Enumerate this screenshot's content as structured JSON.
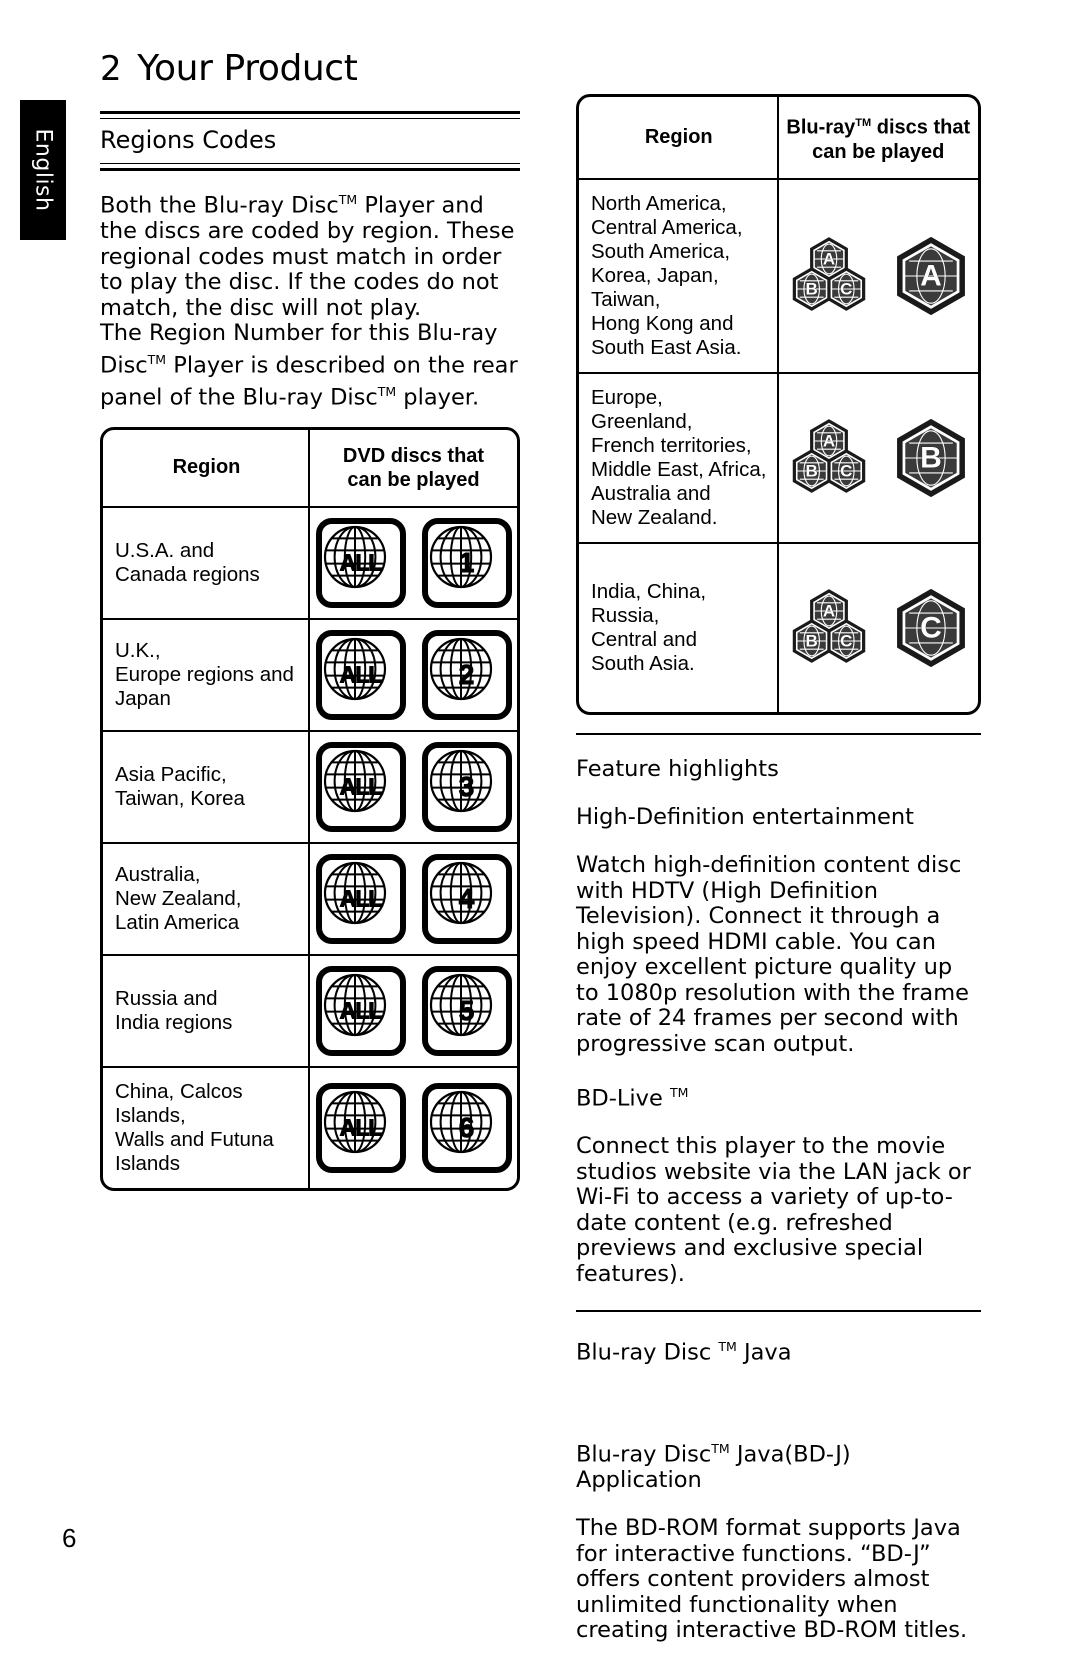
{
  "sidebar": {
    "language_tab": "English"
  },
  "header": {
    "chapter_number": "2",
    "chapter_title": "Your Product"
  },
  "section": {
    "title": "Regions Codes"
  },
  "intro": {
    "paragraph1_a": "Both the Blu-ray Disc",
    "paragraph1_b": " Player and the discs are coded by region. These regional codes must match in order to play the disc. If the codes do not match, the disc will not play.",
    "paragraph2_a": "The Region Number for this Blu-ray Disc",
    "paragraph2_b": " Player is described on the rear panel of the Blu-ray Disc",
    "paragraph2_c": " player.",
    "tm": "TM"
  },
  "dvd_table": {
    "header_region": "Region",
    "header_discs_line1": "DVD discs that",
    "header_discs_line2": "can be played",
    "rows": [
      {
        "region": "U.S.A. and\nCanada regions",
        "icons": [
          "ALL",
          "1"
        ]
      },
      {
        "region": "U.K.,\nEurope regions  and\nJapan",
        "icons": [
          "ALL",
          "2"
        ]
      },
      {
        "region": "Asia Pacific,\nTaiwan, Korea",
        "icons": [
          "ALL",
          "3"
        ]
      },
      {
        "region": "Australia,\nNew Zealand,\nLatin America",
        "icons": [
          "ALL",
          "4"
        ]
      },
      {
        "region": "Russia and\nIndia regions",
        "icons": [
          "ALL",
          "5"
        ]
      },
      {
        "region": "China, Calcos Islands,\nWalls and Futuna\nIslands",
        "icons": [
          "ALL",
          "6"
        ]
      }
    ]
  },
  "bluray_table": {
    "header_region": "Region",
    "header_discs_line1_a": "Blu-ray",
    "header_discs_line1_b": " discs that",
    "header_discs_line2": "can be played",
    "tm": "TM",
    "rows": [
      {
        "region": "North America,\nCentral America,\nSouth America,\nKorea, Japan, Taiwan,\nHong Kong and\nSouth East Asia.",
        "cluster": [
          "A",
          "B",
          "C"
        ],
        "main": "A"
      },
      {
        "region": "Europe, Greenland,\nFrench territories,\nMiddle East, Africa,\nAustralia and\nNew Zealand.",
        "cluster": [
          "A",
          "B",
          "C"
        ],
        "main": "B"
      },
      {
        "region": "India, China, Russia,\nCentral and\nSouth Asia.",
        "cluster": [
          "A",
          "B",
          "C"
        ],
        "main": "C"
      }
    ]
  },
  "features": {
    "heading": "Feature highlights",
    "subheading": "High-Definition entertainment",
    "body": "Watch high-definition content disc with HDTV (High Definition Television). Connect it through a high speed HDMI cable. You can enjoy excellent picture quality up to 1080p resolution with the frame rate of 24 frames per second with progressive scan output.",
    "bdlive_heading_a": "BD-Live ",
    "bdlive_tm": "TM",
    "bdlive_body": "Connect this player to the movie studios website via the LAN jack or Wi-Fi to access a variety of up-to-date content (e.g. refreshed previews and exclusive special features)."
  },
  "java": {
    "heading_a": "Blu-ray Disc  ",
    "heading_tm": "TM",
    "heading_b": " Java",
    "subheading_a": "Blu-ray Disc",
    "subheading_tm": "TM",
    "subheading_b": " Java(BD-J) Application",
    "body": "The BD-ROM format supports Java for interactive functions. “BD-J” offers content providers almost unlimited functionality when creating interactive BD-ROM titles."
  },
  "footer": {
    "page_number": "6"
  },
  "colors": {
    "ink": "#000000",
    "paper": "#ffffff",
    "tab_bg": "#000000",
    "tab_text": "#ffffff"
  }
}
